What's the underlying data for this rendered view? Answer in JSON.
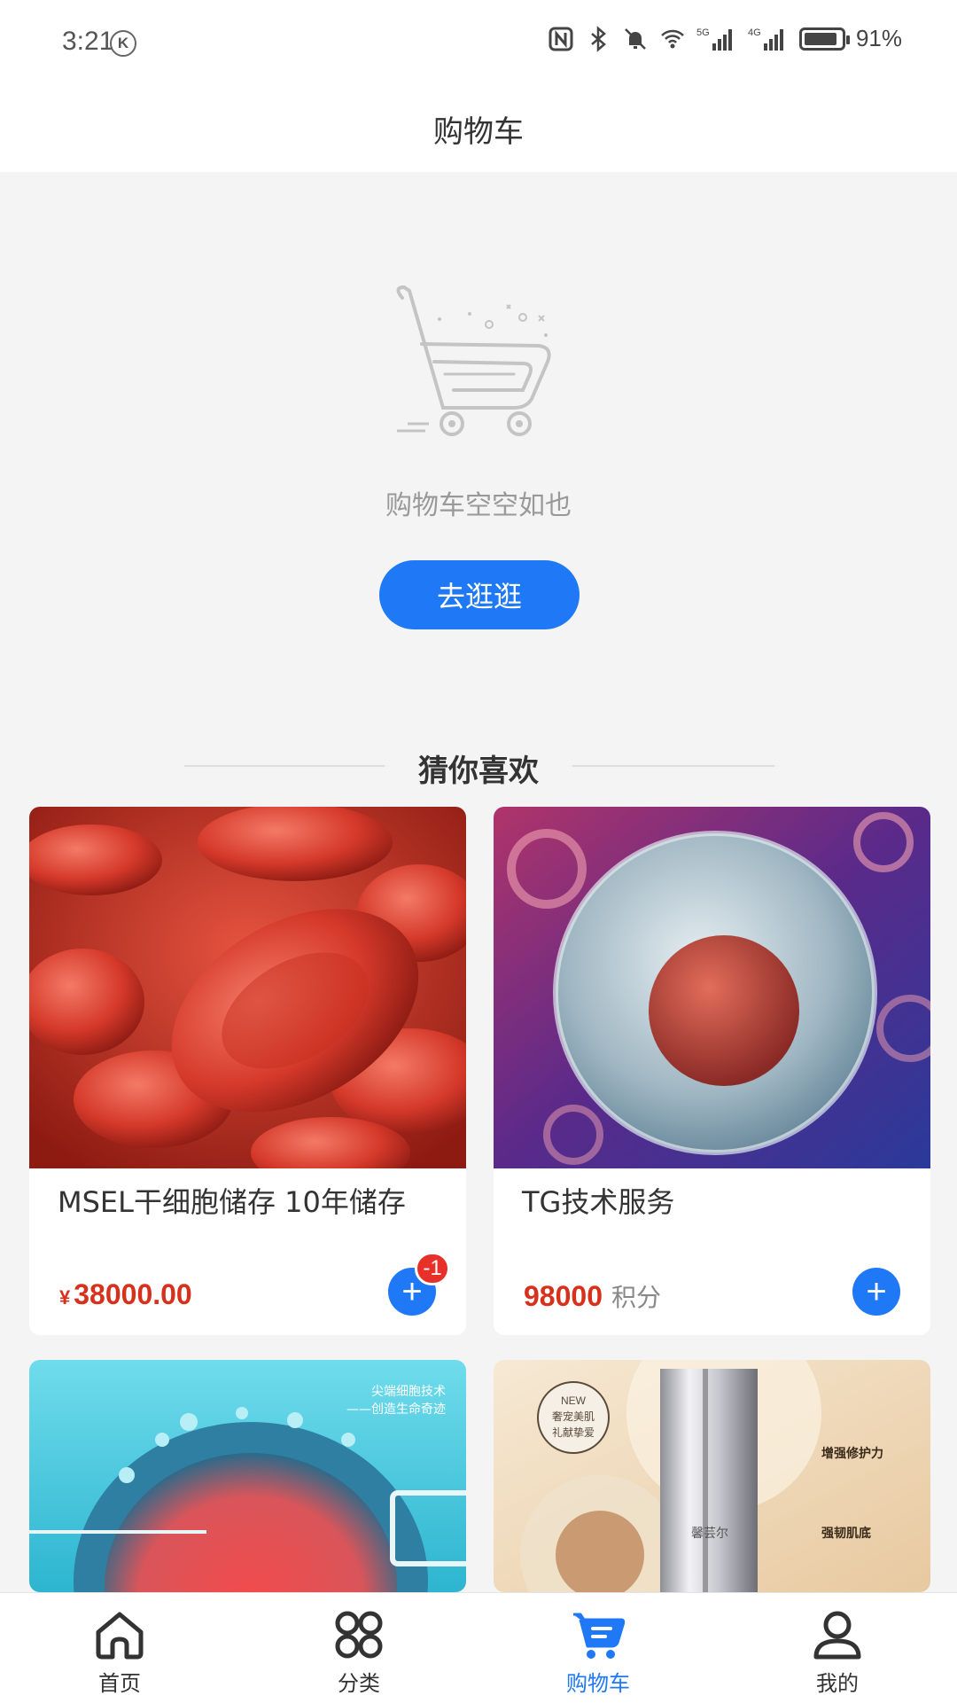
{
  "status_bar": {
    "time": "3:21",
    "k_badge": "K",
    "signal_5g": "5G",
    "signal_4g": "4G",
    "battery_percent": "91%",
    "battery_level": 0.91,
    "icons": [
      "nfc-icon",
      "bluetooth-icon",
      "mute-icon",
      "wifi-icon",
      "signal-5g-icon",
      "signal-4g-icon",
      "battery-icon"
    ]
  },
  "header": {
    "title": "购物车"
  },
  "empty_cart": {
    "illustration": "empty-cart-illustration",
    "message": "购物车空空如也",
    "button_label": "去逛逛"
  },
  "recommend": {
    "title": "猜你喜欢",
    "products": [
      {
        "title": "MSEL干细胞储存 10年储存",
        "currency": "¥",
        "price": "38000.00",
        "unit": "",
        "cart_badge": "-1",
        "image": "red-blood-cells"
      },
      {
        "title": "TG技术服务",
        "currency": "",
        "price": "98000",
        "unit": "积分",
        "cart_badge": "",
        "image": "stem-cell"
      },
      {
        "title": "",
        "currency": "",
        "price": "",
        "unit": "",
        "cart_badge": "",
        "image": "cell-injection",
        "image_caption_1": "尖端细胞技术",
        "image_caption_2": "——创造生命奇迹"
      },
      {
        "title": "",
        "currency": "",
        "price": "",
        "unit": "",
        "cart_badge": "",
        "image": "skincare-bottle",
        "image_badge_1": "NEW",
        "image_badge_2": "奢宠美肌",
        "image_badge_3": "礼献挚爱",
        "brand": "馨芸尔",
        "feature_1": "增强修护力",
        "feature_2": "强韧肌底"
      }
    ]
  },
  "tab_bar": {
    "tabs": [
      {
        "label": "首页",
        "icon": "home-icon"
      },
      {
        "label": "分类",
        "icon": "category-icon"
      },
      {
        "label": "购物车",
        "icon": "cart-icon",
        "active": true
      },
      {
        "label": "我的",
        "icon": "user-icon"
      }
    ]
  },
  "colors": {
    "accent": "#1f78f5",
    "price": "#d7301b",
    "badge": "#e8302a",
    "background": "#f4f4f4"
  }
}
